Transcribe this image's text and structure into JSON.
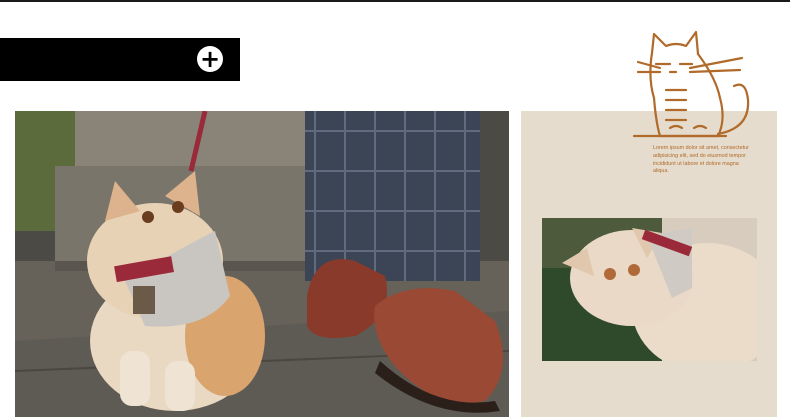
{
  "banner": {
    "plus_icon": "plus-circle-icon",
    "plus_glyph": "+"
  },
  "panel": {
    "lorem_text": "Lorem ipsum dolor sit amet, consectetur adipisicing elit, sed do eiusmod tempor incididunt ut labore et dolore magna aliqua.",
    "doodle_icon": "cat-doodle-icon"
  },
  "photos": {
    "main": "cat-harness-street-photo",
    "inset": "cat-closeup-photo"
  },
  "colors": {
    "banner": "#000000",
    "panel": "#e6dccd",
    "accent": "#b06a2a"
  }
}
